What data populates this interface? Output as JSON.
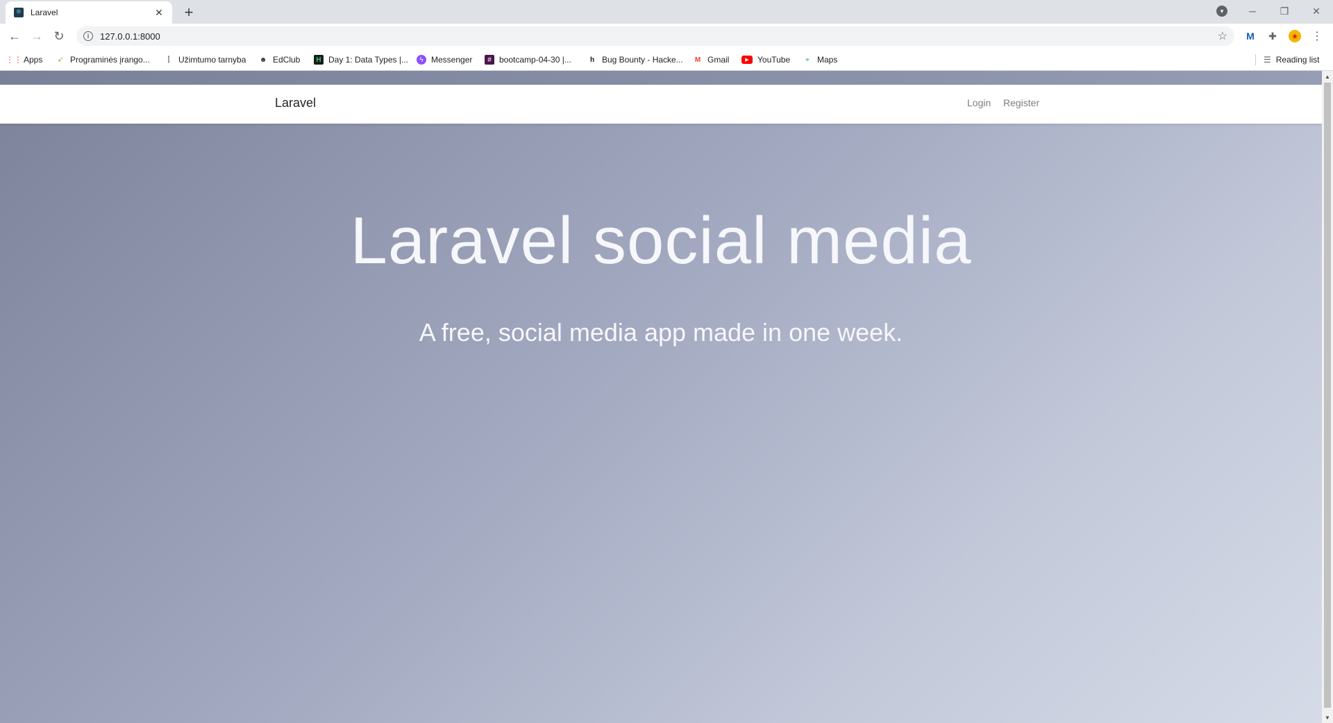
{
  "browser": {
    "tab": {
      "title": "Laravel",
      "favicon": "laravel-atom-icon"
    },
    "url": "127.0.0.1:8000",
    "bookmarks": [
      {
        "label": "Apps",
        "icon": "apps-grid-icon"
      },
      {
        "label": "Programinės įrango...",
        "icon": "leaf-icon"
      },
      {
        "label": "Užimtumo tarnyba",
        "icon": "uzt-icon"
      },
      {
        "label": "EdClub",
        "icon": "edclub-icon"
      },
      {
        "label": "Day 1: Data Types |...",
        "icon": "hackerrank-icon"
      },
      {
        "label": "Messenger",
        "icon": "messenger-icon"
      },
      {
        "label": "bootcamp-04-30 |...",
        "icon": "slack-icon"
      },
      {
        "label": "Bug Bounty - Hacke...",
        "icon": "hackerone-icon"
      },
      {
        "label": "Gmail",
        "icon": "gmail-icon"
      },
      {
        "label": "YouTube",
        "icon": "youtube-icon"
      },
      {
        "label": "Maps",
        "icon": "maps-icon"
      }
    ],
    "reading_list": "Reading list"
  },
  "page": {
    "brand": "Laravel",
    "nav": {
      "login": "Login",
      "register": "Register"
    },
    "hero": {
      "title": "Laravel social media",
      "subtitle": "A free, social media app made in one week."
    }
  }
}
